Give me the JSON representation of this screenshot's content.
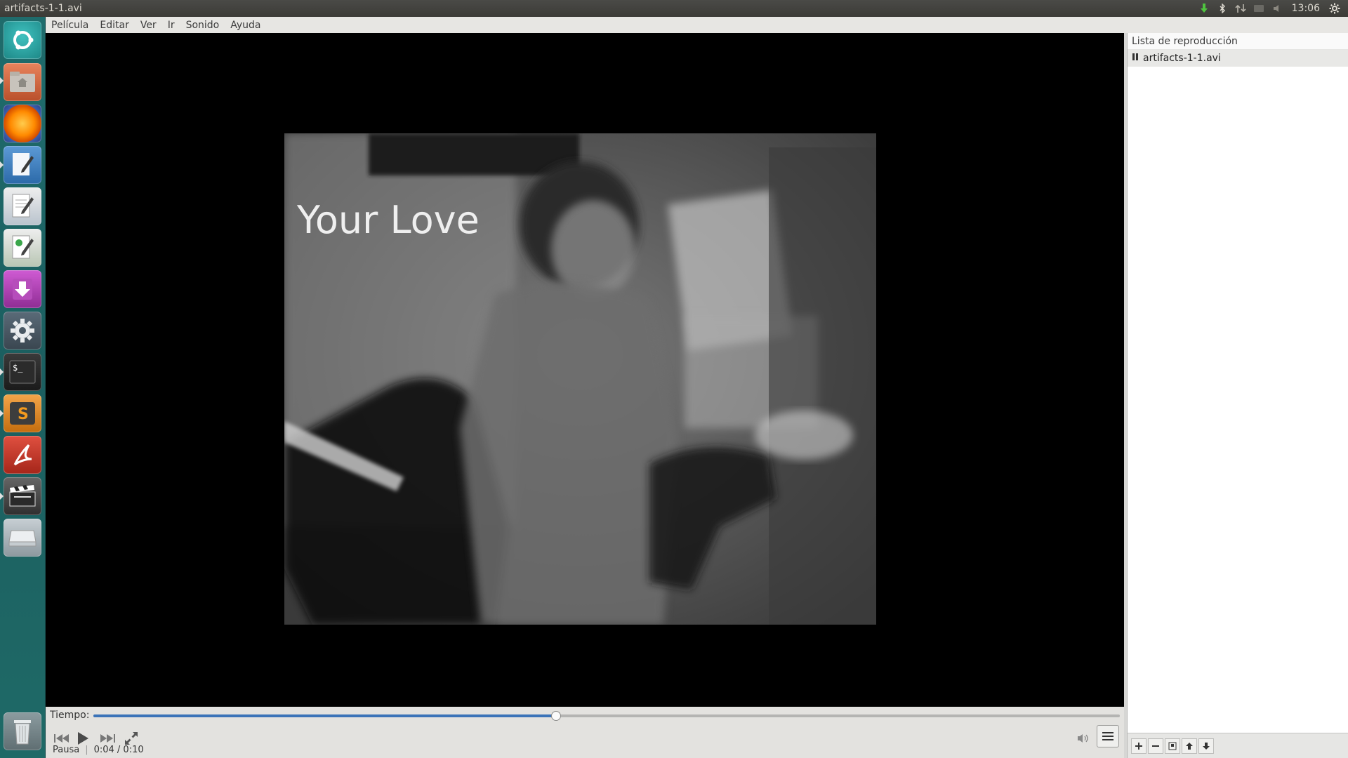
{
  "window": {
    "title": "artifacts-1-1.avi"
  },
  "panel": {
    "clock": "13:06",
    "indicators": [
      "download-icon",
      "bluetooth-icon",
      "network-icon",
      "keyboard-icon",
      "volume-icon",
      "clock",
      "settings-gear-icon"
    ]
  },
  "launcher": {
    "items": [
      {
        "name": "dash-icon",
        "color": "#2aa3a2"
      },
      {
        "name": "home-folder-icon",
        "color": "#d8673e"
      },
      {
        "name": "firefox-icon",
        "color": "#e66000"
      },
      {
        "name": "writer-icon",
        "color": "#3b82c4"
      },
      {
        "name": "text-editor-icon",
        "color": "#5a7fa8"
      },
      {
        "name": "impress-icon",
        "color": "#3a9a4a"
      },
      {
        "name": "software-center-icon",
        "color": "#b33fb8"
      },
      {
        "name": "system-settings-icon",
        "color": "#4b5c6a"
      },
      {
        "name": "terminal-icon",
        "color": "#2e2e2e"
      },
      {
        "name": "sublime-text-icon",
        "color": "#e58a17"
      },
      {
        "name": "pdf-reader-icon",
        "color": "#c0392b"
      },
      {
        "name": "videos-player-icon",
        "color": "#444444"
      },
      {
        "name": "removable-drive-icon",
        "color": "#9aa6ad"
      },
      {
        "name": "trash-icon",
        "color": "#7b8c8f"
      }
    ]
  },
  "menubar": [
    "Película",
    "Editar",
    "Ver",
    "Ir",
    "Sonido",
    "Ayuda"
  ],
  "video": {
    "caption": "Your Love"
  },
  "playlist": {
    "header": "Lista de reproducción",
    "items": [
      {
        "label": "artifacts-1-1.avi",
        "state": "paused"
      }
    ],
    "toolbar": [
      "add-icon",
      "remove-icon",
      "save-icon",
      "move-up-icon",
      "move-down-icon"
    ]
  },
  "controls": {
    "time_label": "Tiempo:",
    "progress": 0.4505,
    "status": "Pausa",
    "time": "0:04 / 0:10"
  }
}
